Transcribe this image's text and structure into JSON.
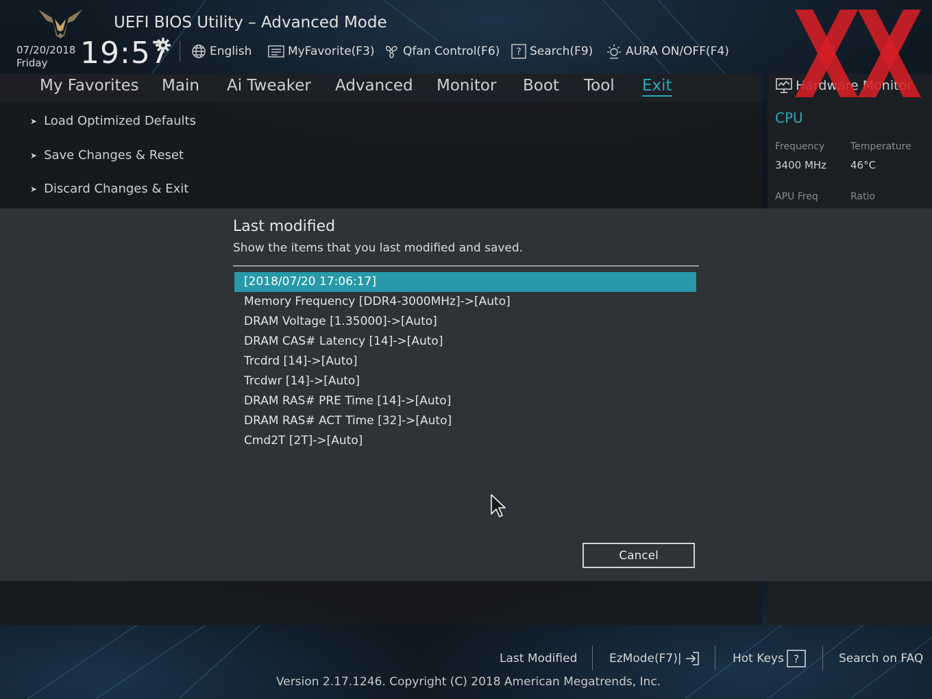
{
  "header": {
    "title": "UEFI BIOS Utility – Advanced Mode",
    "date": "07/20/2018",
    "day": "Friday",
    "time": "19:57",
    "tools": {
      "language": "English",
      "favorite": "MyFavorite(F3)",
      "qfan": "Qfan Control(F6)",
      "search": "Search(F9)",
      "aura": "AURA ON/OFF(F4)"
    }
  },
  "nav": {
    "tabs": [
      "My Favorites",
      "Main",
      "Ai Tweaker",
      "Advanced",
      "Monitor",
      "Boot",
      "Tool",
      "Exit"
    ],
    "active": "Exit"
  },
  "exit_menu": {
    "items": [
      "Load Optimized Defaults",
      "Save Changes & Reset",
      "Discard Changes & Exit"
    ]
  },
  "hardware_monitor": {
    "title": "Hardware Monitor",
    "section": "CPU",
    "frequency_label": "Frequency",
    "frequency_value": "3400 MHz",
    "temperature_label": "Temperature",
    "temperature_value": "46°C",
    "apu_label": "APU Freq",
    "ratio_label": "Ratio"
  },
  "dialog": {
    "title": "Last modified",
    "subtitle": "Show the items that you last modified and saved.",
    "entries": [
      "[2018/07/20 17:06:17]",
      "Memory Frequency [DDR4-3000MHz]->[Auto]",
      "DRAM Voltage [1.35000]->[Auto]",
      "DRAM CAS# Latency [14]->[Auto]",
      "Trcdrd [14]->[Auto]",
      "Trcdwr [14]->[Auto]",
      "DRAM RAS# PRE Time [14]->[Auto]",
      "DRAM RAS# ACT Time [32]->[Auto]",
      "Cmd2T [2T]->[Auto]"
    ],
    "selected_index": 0,
    "cancel_label": "Cancel"
  },
  "footer": {
    "last_modified": "Last Modified",
    "ezmode": "EzMode(F7)|",
    "hotkeys": "Hot Keys",
    "faq": "Search on FAQ",
    "version": "Version 2.17.1246. Copyright (C) 2018 American Megatrends, Inc."
  },
  "colors": {
    "accent": "#2aaab8",
    "selection": "#2799a8",
    "dialog_bg": "#2f3236",
    "watermark": "#d61f26"
  },
  "icons": {
    "logo": "tuf-eagle-logo",
    "watermark": "xx-watermark",
    "clock_settings": "gear-icon",
    "language": "globe-icon",
    "favorite": "favorite-list-icon",
    "qfan": "fan-icon",
    "search": "search-question-icon",
    "aura": "aura-light-icon",
    "hardware_monitor": "monitor-icon",
    "ezmode": "exit-arrow-icon",
    "hotkeys": "question-box-icon",
    "cursor": "mouse-pointer-icon"
  }
}
